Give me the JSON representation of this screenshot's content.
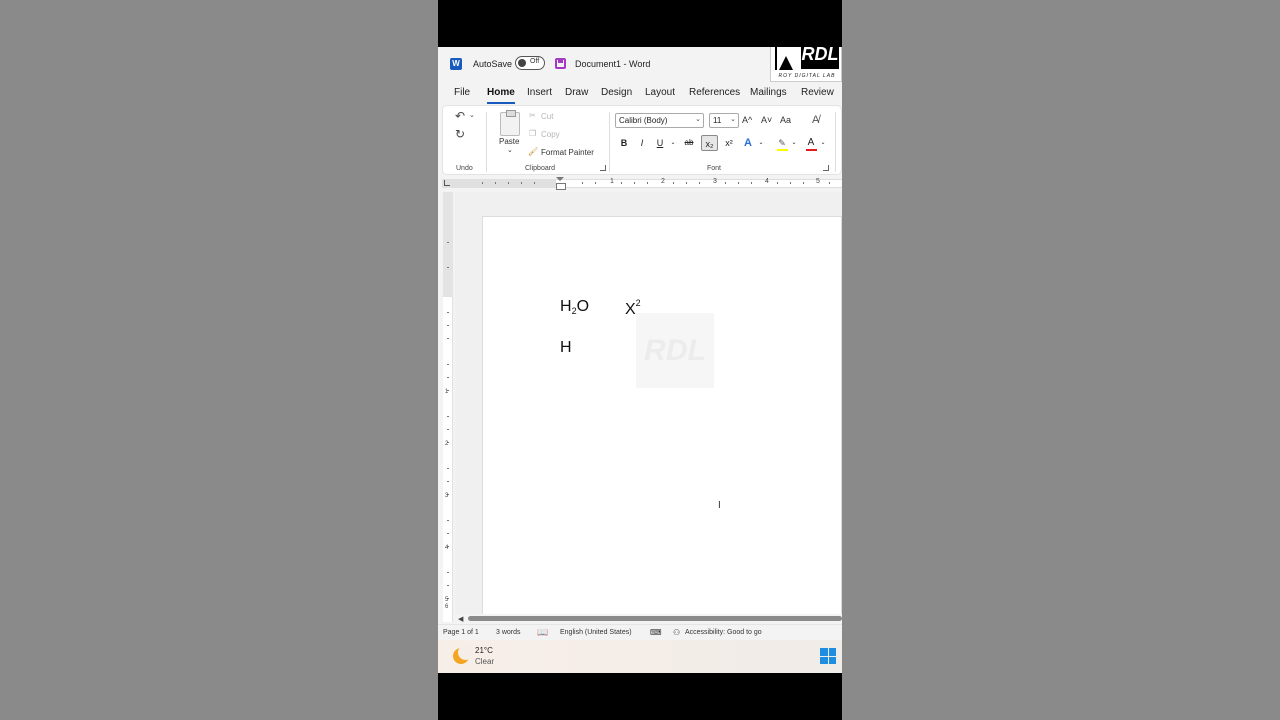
{
  "titlebar": {
    "autosave_label": "AutoSave",
    "autosave_state": "Off",
    "document_title": "Document1  -  Word",
    "logo_text": "RDL",
    "logo_subtitle": "ROY DIGITAL LAB"
  },
  "tabs": [
    "File",
    "Home",
    "Insert",
    "Draw",
    "Design",
    "Layout",
    "References",
    "Mailings",
    "Review"
  ],
  "active_tab": "Home",
  "ribbon": {
    "undo_group_label": "Undo",
    "clipboard": {
      "paste_label": "Paste",
      "cut_label": "Cut",
      "copy_label": "Copy",
      "format_painter_label": "Format Painter",
      "group_label": "Clipboard"
    },
    "font": {
      "font_name": "Calibri (Body)",
      "font_size": "11",
      "grow_label": "A^",
      "shrink_label": "A˅",
      "case_label": "Aa",
      "bold": "B",
      "italic": "I",
      "underline": "U",
      "strike": "ab",
      "subscript": "x₂",
      "superscript": "x²",
      "group_label": "Font"
    }
  },
  "ruler": {
    "h_numbers": [
      "1",
      "2",
      "3",
      "4",
      "5"
    ],
    "v_numbers": [
      "1",
      "2",
      "3",
      "4",
      "5",
      "6"
    ]
  },
  "document": {
    "line1_a_base": "H",
    "line1_a_sub": "2",
    "line1_a_tail": "O",
    "line1_b_base": "X",
    "line1_b_sup": "2",
    "line2": "H",
    "watermark": "RDL"
  },
  "statusbar": {
    "page": "Page 1 of 1",
    "words": "3 words",
    "language": "English (United States)",
    "accessibility": "Accessibility: Good to go"
  },
  "taskbar": {
    "temperature": "21°C",
    "condition": "Clear"
  },
  "colors": {
    "accent": "#185abd",
    "highlight": "#ffff00",
    "font_color": "#e31b1b"
  }
}
